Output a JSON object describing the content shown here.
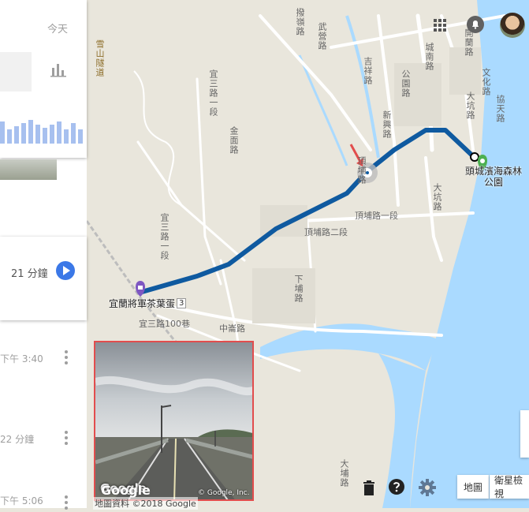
{
  "panel": {
    "date_label": "今天",
    "duration": "21 分鐘",
    "rows": [
      {
        "time": "下午 3:40"
      },
      {
        "time": "22 分鐘"
      },
      {
        "time": "下午 5:06"
      }
    ]
  },
  "map": {
    "origin_label": "宜蘭將軍茶葉蛋",
    "destination_label": "頭城濱海森林公園",
    "road_badge": "3",
    "roads": [
      "雪山隧道",
      "宜三路一段",
      "宜三路一段",
      "吉祥路",
      "公園路",
      "武營路",
      "新興路",
      "金面路",
      "頂埔路二段",
      "頂埔路一段",
      "頂埔路",
      "下埔路",
      "中崙路",
      "大坑路",
      "大坑路",
      "文化路",
      "開蘭路",
      "協天路",
      "宜三路100巷",
      "城南路",
      "大埔路",
      "撥嶺路"
    ]
  },
  "street_view": {
    "logo": "Google",
    "copyright": "© Google, Inc."
  },
  "controls": {
    "map_button": "地圖",
    "satellite_button": "衛星檢視"
  },
  "footer": {
    "attribution": "地圖資料 ©2018 Google",
    "google_logo": "Google"
  }
}
